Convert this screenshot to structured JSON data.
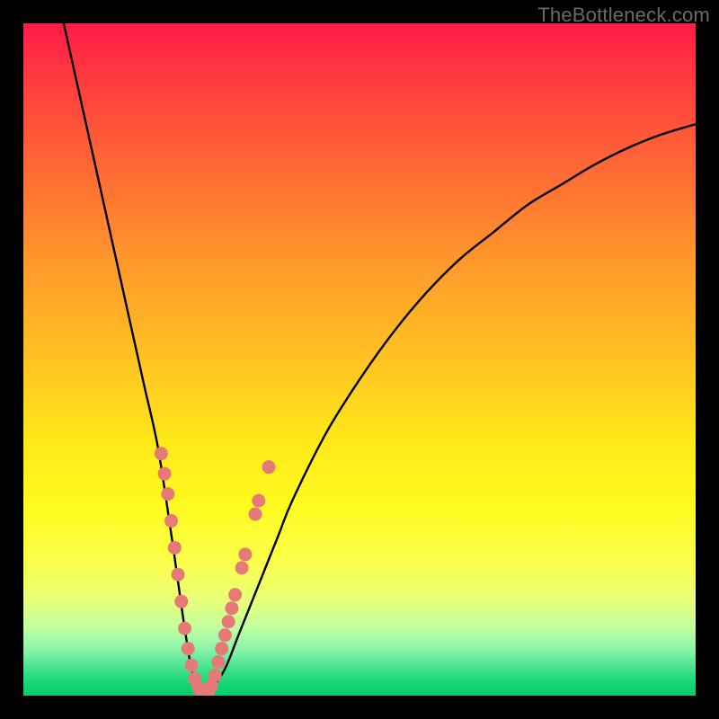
{
  "watermark": "TheBottleneck.com",
  "colors": {
    "frame": "#000000",
    "curve": "#000000",
    "marker_fill": "#e77a76",
    "marker_stroke": "#d86a66",
    "green_band": "#06ce6c"
  },
  "chart_data": {
    "type": "line",
    "title": "",
    "xlabel": "",
    "ylabel": "",
    "xlim": [
      0,
      100
    ],
    "ylim": [
      0,
      100
    ],
    "grid": false,
    "legend": false,
    "series": [
      {
        "name": "bottleneck-curve",
        "x": [
          6,
          8,
          10,
          12,
          14,
          16,
          18,
          20,
          22,
          23,
          24,
          25,
          26,
          27,
          28,
          30,
          32,
          34,
          36,
          38,
          40,
          45,
          50,
          55,
          60,
          65,
          70,
          75,
          80,
          85,
          90,
          95,
          100
        ],
        "y": [
          100,
          91,
          82,
          73,
          64,
          55,
          46,
          37,
          24,
          17,
          10,
          4,
          1,
          0,
          1,
          4,
          9,
          14,
          19,
          24,
          29,
          39,
          47,
          54,
          60,
          65,
          69,
          73,
          76,
          79,
          81.5,
          83.5,
          85
        ],
        "note": "Values are approximate readings of the black curve; y=0 at bottom (green), y=100 at top (red). Minimum near x≈26-27."
      }
    ],
    "markers": {
      "name": "sample-points",
      "note": "Salmon dots overlaid on the curve near the bottom of the V.",
      "points": [
        {
          "x": 20.5,
          "y": 36
        },
        {
          "x": 21.0,
          "y": 33
        },
        {
          "x": 21.5,
          "y": 30
        },
        {
          "x": 22.0,
          "y": 26
        },
        {
          "x": 22.5,
          "y": 22
        },
        {
          "x": 23.0,
          "y": 18
        },
        {
          "x": 23.5,
          "y": 14
        },
        {
          "x": 24.0,
          "y": 10
        },
        {
          "x": 24.5,
          "y": 7
        },
        {
          "x": 25.0,
          "y": 4.5
        },
        {
          "x": 25.5,
          "y": 2.5
        },
        {
          "x": 26.0,
          "y": 1.2
        },
        {
          "x": 26.5,
          "y": 0.5
        },
        {
          "x": 27.0,
          "y": 0.3
        },
        {
          "x": 27.5,
          "y": 0.6
        },
        {
          "x": 28.0,
          "y": 1.5
        },
        {
          "x": 28.5,
          "y": 3
        },
        {
          "x": 29.0,
          "y": 5
        },
        {
          "x": 29.5,
          "y": 7
        },
        {
          "x": 30.0,
          "y": 9
        },
        {
          "x": 30.5,
          "y": 11
        },
        {
          "x": 31.0,
          "y": 13
        },
        {
          "x": 31.5,
          "y": 15
        },
        {
          "x": 32.5,
          "y": 19
        },
        {
          "x": 33.0,
          "y": 21
        },
        {
          "x": 34.5,
          "y": 27
        },
        {
          "x": 35.0,
          "y": 29
        },
        {
          "x": 36.5,
          "y": 34
        }
      ]
    },
    "background_gradient": {
      "top": "#ff1a49",
      "mid": "#ffe81a",
      "bottom": "#06ce6c",
      "meaning": "red=high bottleneck, green=low bottleneck"
    }
  }
}
